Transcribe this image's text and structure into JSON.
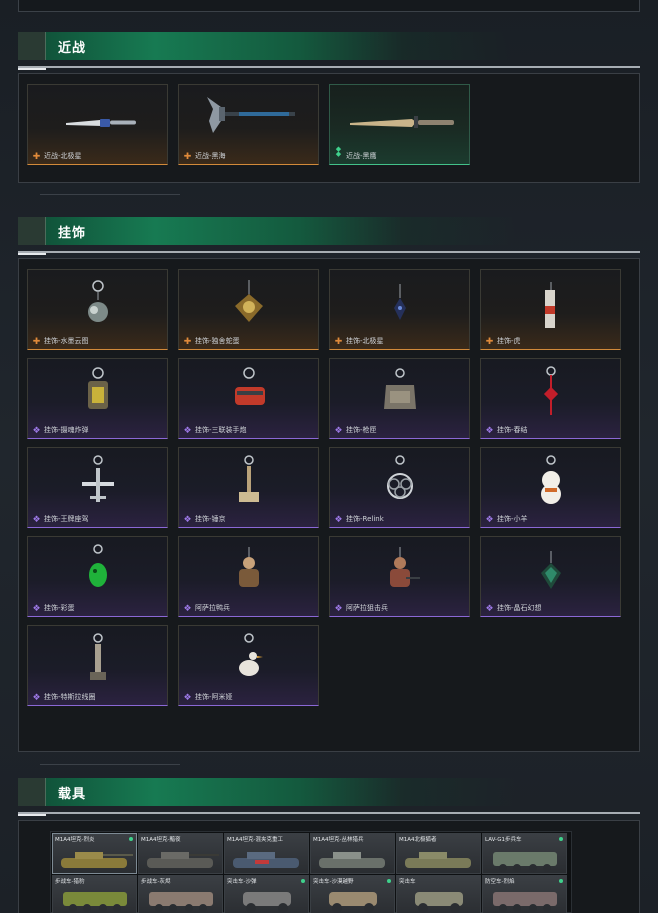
{
  "sections": {
    "melee": {
      "title": "近战"
    },
    "charms": {
      "title": "挂饰"
    },
    "vehicles": {
      "title": "载具"
    }
  },
  "melee_items": [
    {
      "label": "近战-北极星",
      "rarity": "orange",
      "icon": "knife-icon"
    },
    {
      "label": "近战-黑海",
      "rarity": "orange",
      "icon": "axe-icon"
    },
    {
      "label": "近战-黑鹰",
      "rarity": "green",
      "icon": "dagger-icon"
    }
  ],
  "charm_items": [
    {
      "label": "挂饰-水墨云图",
      "rarity": "orange",
      "icon": "ink-charm-icon"
    },
    {
      "label": "挂饰-独舍蛇蛋",
      "rarity": "orange",
      "icon": "emblem-charm-icon"
    },
    {
      "label": "挂饰-北极星",
      "rarity": "orange",
      "icon": "star-charm-icon"
    },
    {
      "label": "挂饰-虎",
      "rarity": "orange",
      "icon": "tiger-charm-icon"
    },
    {
      "label": "挂饰-摄魂炸弹",
      "rarity": "purple",
      "icon": "bomb-charm-icon"
    },
    {
      "label": "挂饰-三联装手炮",
      "rarity": "purple",
      "icon": "cannon-charm-icon"
    },
    {
      "label": "挂饰-枪匣",
      "rarity": "purple",
      "icon": "case-charm-icon"
    },
    {
      "label": "挂饰-春结",
      "rarity": "purple",
      "icon": "knot-charm-icon"
    },
    {
      "label": "挂饰-王牌座驾",
      "rarity": "purple",
      "icon": "plane-charm-icon"
    },
    {
      "label": "挂饰-锤京",
      "rarity": "purple",
      "icon": "hammer-charm-icon"
    },
    {
      "label": "挂饰-Relink",
      "rarity": "purple",
      "icon": "rings-charm-icon"
    },
    {
      "label": "挂饰-小羊",
      "rarity": "purple",
      "icon": "sheep-charm-icon"
    },
    {
      "label": "挂饰-彩蛋",
      "rarity": "purple",
      "icon": "egg-charm-icon"
    },
    {
      "label": "阿萨拉鸭兵",
      "rarity": "purple",
      "icon": "soldier-charm-icon"
    },
    {
      "label": "阿萨拉狙击兵",
      "rarity": "purple",
      "icon": "sniper-charm-icon"
    },
    {
      "label": "挂饰-晶石幻想",
      "rarity": "purple",
      "icon": "crystal-charm-icon"
    },
    {
      "label": "挂饰-特斯拉线圈",
      "rarity": "purple",
      "icon": "coil-charm-icon"
    },
    {
      "label": "挂饰-阿米娅",
      "rarity": "purple",
      "icon": "goose-charm-icon"
    }
  ],
  "vehicle_items": [
    {
      "label": "M1A4坦克-烈炎",
      "dot": true,
      "color": "#8a7a3a"
    },
    {
      "label": "M1A4坦克-黯夜",
      "dot": false,
      "color": "#6a6a66"
    },
    {
      "label": "M1A4坦克-混夹克重工",
      "dot": false,
      "color": "#5a6a80"
    },
    {
      "label": "M1A4坦克-丛林猎兵",
      "dot": false,
      "color": "#6a706a"
    },
    {
      "label": "M1A4北极狐者",
      "dot": false,
      "color": "#7a7a58"
    },
    {
      "label": "LAV-G1步兵车",
      "dot": true,
      "color": "#6a7a6a"
    },
    {
      "label": "步战车-猎豹",
      "dot": false,
      "color": "#7a8a3a"
    },
    {
      "label": "步战车-灰烬",
      "dot": false,
      "color": "#8a7a70"
    },
    {
      "label": "突击车-沙弹",
      "dot": true,
      "color": "#7a7a7a"
    },
    {
      "label": "突击车-沙漠越野",
      "dot": true,
      "color": "#9a8a70"
    },
    {
      "label": "突击车",
      "dot": false,
      "color": "#8a8a76"
    },
    {
      "label": "防空车-烈焰",
      "dot": true,
      "color": "#7a6a6a"
    }
  ]
}
